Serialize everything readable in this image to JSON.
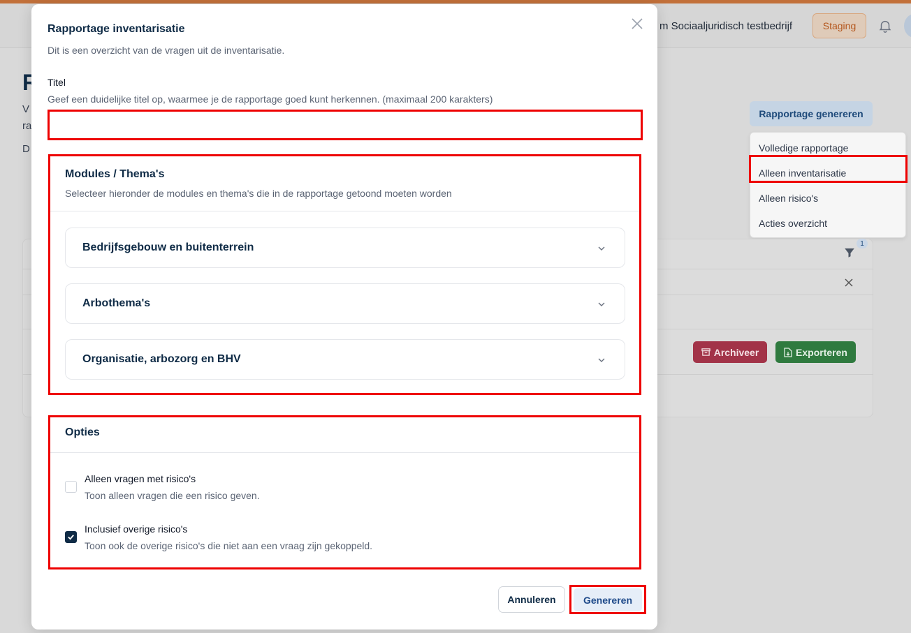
{
  "app": {
    "company": "m Sociaaljuridisch testbedrijf",
    "env_badge": "Staging",
    "page_title_fragment": "R",
    "desc_fragment_1": "V",
    "desc_fragment_2": "ra",
    "desc_fragment_3": "D",
    "generate_button": "Rapportage genereren",
    "dropdown": [
      "Volledige rapportage",
      "Alleen inventarisatie",
      "Alleen risico's",
      "Acties overzicht"
    ],
    "filter_count": "1",
    "archive_label": "Archiveer",
    "export_label": "Exporteren"
  },
  "modal": {
    "title": "Rapportage inventarisatie",
    "subtitle": "Dit is een overzicht van de vragen uit de inventarisatie.",
    "titel_label": "Titel",
    "titel_help": "Geef een duidelijke titel op, waarmee je de rapportage goed kunt herkennen. (maximaal 200 karakters)",
    "titel_value": "",
    "modules": {
      "title": "Modules / Thema's",
      "subtitle": "Selecteer hieronder de modules en thema's die in de rapportage getoond moeten worden",
      "items": [
        "Bedrijfsgebouw en buitenterrein",
        "Arbothema's",
        "Organisatie, arbozorg en BHV"
      ]
    },
    "options": {
      "title": "Opties",
      "items": [
        {
          "label": "Alleen vragen met risico's",
          "help": "Toon alleen vragen die een risico geven.",
          "checked": false
        },
        {
          "label": "Inclusief overige risico's",
          "help": "Toon ook de overige risico's die niet aan een vraag zijn gekoppeld.",
          "checked": true
        }
      ]
    },
    "cancel_label": "Annuleren",
    "generate_label": "Genereren"
  },
  "colors": {
    "accent": "#0f2b46",
    "highlight": "#e00000",
    "archive": "#a23348",
    "export": "#2f7a3f"
  }
}
